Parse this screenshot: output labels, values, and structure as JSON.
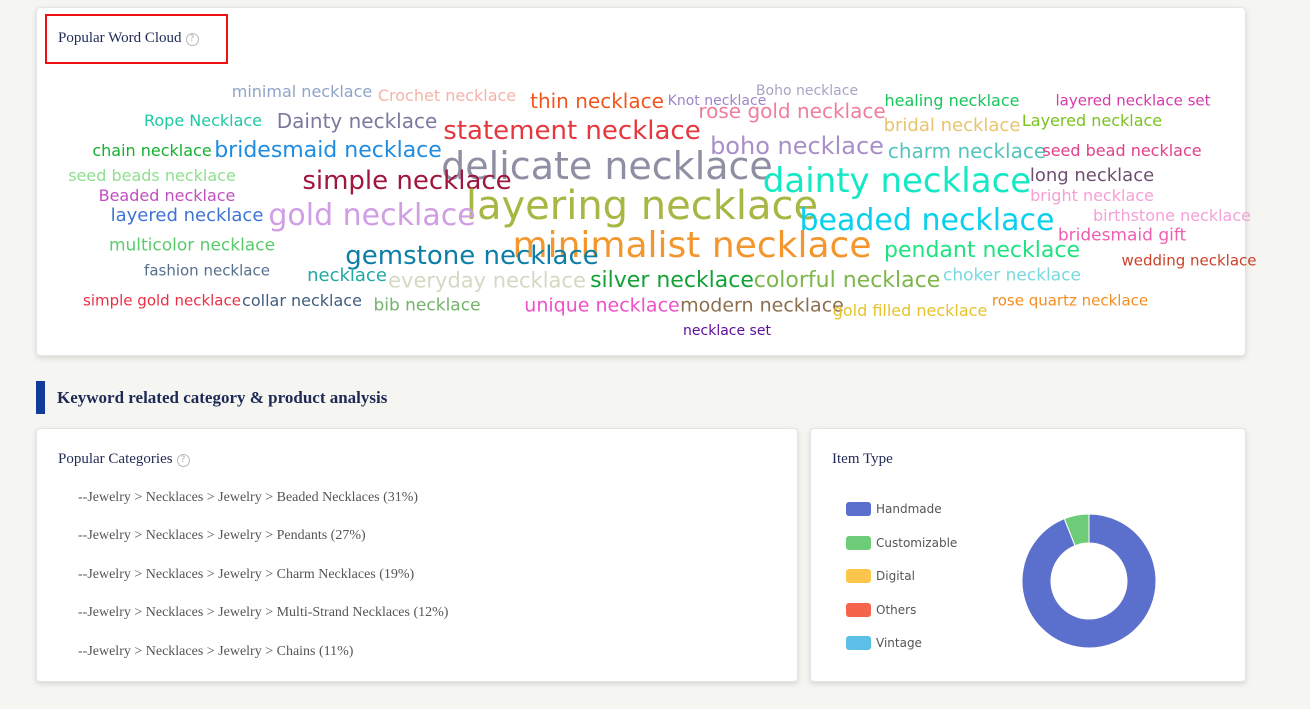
{
  "word_cloud": {
    "title": "Popular Word Cloud",
    "help_icon": "?",
    "words": [
      {
        "text": "minimal necklace",
        "color": "#8fa4c8",
        "size": 16
      },
      {
        "text": "Crochet necklace",
        "color": "#f4b3a8",
        "size": 16
      },
      {
        "text": "thin necklace",
        "color": "#f2561d",
        "size": 20
      },
      {
        "text": "Knot necklace",
        "color": "#9b86c7",
        "size": 14
      },
      {
        "text": "Boho necklace",
        "color": "#a9a4c4",
        "size": 14
      },
      {
        "text": "rose gold necklace",
        "color": "#ef7e9c",
        "size": 20
      },
      {
        "text": "healing necklace",
        "color": "#19c45c",
        "size": 16
      },
      {
        "text": "layered necklace set",
        "color": "#d63aa8",
        "size": 15
      },
      {
        "text": "Rope Necklace",
        "color": "#1fcaa5",
        "size": 16
      },
      {
        "text": "Dainty necklace",
        "color": "#7a7aa0",
        "size": 20
      },
      {
        "text": "statement necklace",
        "color": "#e4383e",
        "size": 26
      },
      {
        "text": "bridal necklace",
        "color": "#eac36f",
        "size": 18
      },
      {
        "text": "Layered necklace",
        "color": "#7ac21e",
        "size": 16
      },
      {
        "text": "boho necklace",
        "color": "#a98fc8",
        "size": 24
      },
      {
        "text": "chain necklace",
        "color": "#15b02d",
        "size": 16
      },
      {
        "text": "bridesmaid necklace",
        "color": "#1e8ce0",
        "size": 22
      },
      {
        "text": "delicate necklace",
        "color": "#8f8fa4",
        "size": 38
      },
      {
        "text": "charm necklace",
        "color": "#55c4bc",
        "size": 20
      },
      {
        "text": "seed bead necklace",
        "color": "#e2408a",
        "size": 16
      },
      {
        "text": "seed beads necklace",
        "color": "#8ee08e",
        "size": 16
      },
      {
        "text": "simple necklace",
        "color": "#a0173d",
        "size": 26
      },
      {
        "text": "dainty necklace",
        "color": "#14e8c4",
        "size": 34
      },
      {
        "text": "long necklace",
        "color": "#6f4f6f",
        "size": 18
      },
      {
        "text": "Beaded necklace",
        "color": "#c04fc0",
        "size": 16
      },
      {
        "text": "layering necklace",
        "color": "#a8b644",
        "size": 40
      },
      {
        "text": "bright necklace",
        "color": "#f59fd6",
        "size": 16
      },
      {
        "text": "layered necklace",
        "color": "#3f74d4",
        "size": 18
      },
      {
        "text": "gold necklace",
        "color": "#d09ee4",
        "size": 30
      },
      {
        "text": "beaded necklace",
        "color": "#0ad0ee",
        "size": 30
      },
      {
        "text": "birthstone necklace",
        "color": "#f5a0d8",
        "size": 16
      },
      {
        "text": "bridesmaid gift",
        "color": "#ee5fb4",
        "size": 17
      },
      {
        "text": "multicolor necklace",
        "color": "#5acb6a",
        "size": 17
      },
      {
        "text": "minimalist necklace",
        "color": "#f3962d",
        "size": 36
      },
      {
        "text": "gemstone necklace",
        "color": "#0d7ea6",
        "size": 26
      },
      {
        "text": "pendant necklace",
        "color": "#1fe280",
        "size": 22
      },
      {
        "text": "fashion necklace",
        "color": "#566e8e",
        "size": 15
      },
      {
        "text": "wedding necklace",
        "color": "#cc4128",
        "size": 15
      },
      {
        "text": "necklace",
        "color": "#20a8a3",
        "size": 18
      },
      {
        "text": "everyday necklace",
        "color": "#d4d9c4",
        "size": 21
      },
      {
        "text": "silver necklace",
        "color": "#14a236",
        "size": 22
      },
      {
        "text": "colorful necklace",
        "color": "#7db64a",
        "size": 22
      },
      {
        "text": "choker necklace",
        "color": "#7ad8e0",
        "size": 17
      },
      {
        "text": "simple gold necklace",
        "color": "#ec2e44",
        "size": 15
      },
      {
        "text": "collar necklace",
        "color": "#3f5d7f",
        "size": 16
      },
      {
        "text": "bib necklace",
        "color": "#74b26c",
        "size": 17
      },
      {
        "text": "unique necklace",
        "color": "#f04fc8",
        "size": 19
      },
      {
        "text": "modern necklace",
        "color": "#8c6e4e",
        "size": 19
      },
      {
        "text": "gold filled necklace",
        "color": "#e6c32a",
        "size": 16
      },
      {
        "text": "rose quartz necklace",
        "color": "#f58d1e",
        "size": 15
      },
      {
        "text": "necklace set",
        "color": "#5a0e9a",
        "size": 14
      }
    ]
  },
  "section": {
    "title": "Keyword related category & product analysis"
  },
  "categories": {
    "title": "Popular Categories",
    "help_icon": "?",
    "items": [
      "--Jewelry > Necklaces > Jewelry > Beaded Necklaces (31%)",
      "--Jewelry > Necklaces > Jewelry > Pendants (27%)",
      "--Jewelry > Necklaces > Jewelry > Charm Necklaces (19%)",
      "--Jewelry > Necklaces > Jewelry > Multi-Strand Necklaces (12%)",
      "--Jewelry > Necklaces > Jewelry > Chains (11%)"
    ]
  },
  "item_type": {
    "title": "Item Type",
    "chart_data": {
      "type": "pie",
      "donut": true,
      "title": "",
      "legend_position": "left",
      "categories": [
        "Handmade",
        "Customizable",
        "Digital",
        "Others",
        "Vintage"
      ],
      "values": [
        94,
        6,
        0,
        0,
        0
      ],
      "colors": [
        "#5b6fcc",
        "#6ccc78",
        "#fcc64c",
        "#f5654b",
        "#5cbfe8"
      ]
    }
  }
}
